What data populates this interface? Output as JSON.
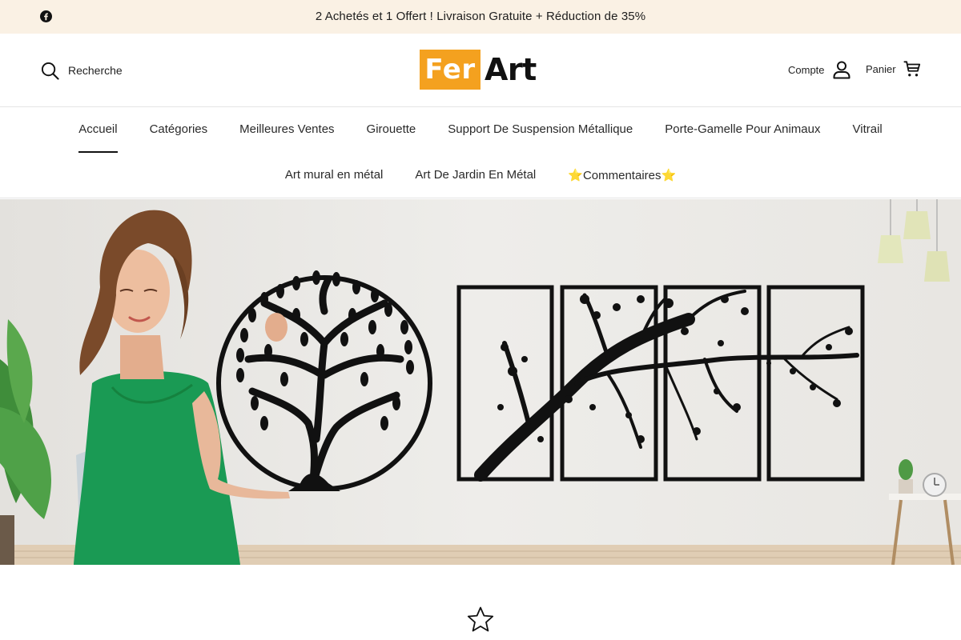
{
  "announcement": {
    "text": "2 Achetés et 1 Offert ! Livraison Gratuite + Réduction de 35%",
    "social_icon": "facebook-icon"
  },
  "header": {
    "search_label": "Recherche",
    "logo": {
      "part1": "Fer",
      "part2": "Art",
      "accent_color": "#f4a11f"
    },
    "account_label": "Compte",
    "cart_label": "Panier"
  },
  "nav": {
    "row1": [
      {
        "label": "Accueil",
        "active": true
      },
      {
        "label": "Catégories"
      },
      {
        "label": "Meilleures Ventes"
      },
      {
        "label": "Girouette"
      },
      {
        "label": "Support De Suspension Métallique"
      },
      {
        "label": "Porte-Gamelle Pour Animaux"
      },
      {
        "label": "Vitrail"
      }
    ],
    "row2": [
      {
        "label": "Art mural en métal"
      },
      {
        "label": "Art De Jardin En Métal"
      },
      {
        "label": "⭐Commentaires⭐"
      }
    ]
  },
  "hero": {
    "image": "woman in green dress holding circular tree-of-life metal wall art next to a four-panel metal tree branch wall art"
  },
  "colors": {
    "announcement_bg": "#faf1e4",
    "dress_green": "#1a9a54"
  }
}
